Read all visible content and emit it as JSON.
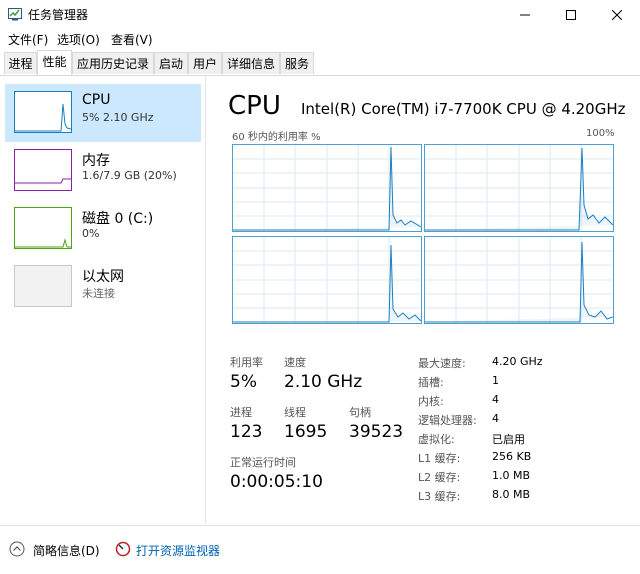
{
  "window": {
    "title": "任务管理器"
  },
  "menu": [
    "文件(F)",
    "选项(O)",
    "查看(V)"
  ],
  "tabs": [
    "进程",
    "性能",
    "应用历史记录",
    "启动",
    "用户",
    "详细信息",
    "服务"
  ],
  "sidebar": {
    "items": [
      {
        "name": "CPU",
        "value": "5%  2.10 GHz",
        "color": "#1b7fbf"
      },
      {
        "name": "内存",
        "value": "1.6/7.9 GB (20%)",
        "color": "#8b1fa8"
      },
      {
        "name": "磁盘 0 (C:)",
        "value": "0%",
        "color": "#4da60c"
      },
      {
        "name": "以太网",
        "value": "未连接",
        "color": "#b0b0b0"
      }
    ]
  },
  "main": {
    "title": "CPU",
    "model": "Intel(R) Core(TM) i7-7700K CPU @ 4.20GHz",
    "graph_label": "60 秒内的利用率 %",
    "graph_max": "100%",
    "stats": {
      "util_label": "利用率",
      "util_value": "5%",
      "speed_label": "速度",
      "speed_value": "2.10 GHz",
      "proc_label": "进程",
      "proc_value": "123",
      "thread_label": "线程",
      "thread_value": "1695",
      "handle_label": "句柄",
      "handle_value": "39523",
      "uptime_label": "正常运行时间",
      "uptime_value": "0:00:05:10"
    },
    "details": [
      {
        "key": "最大速度:",
        "value": "4.20 GHz"
      },
      {
        "key": "插槽:",
        "value": "1"
      },
      {
        "key": "内核:",
        "value": "4"
      },
      {
        "key": "逻辑处理器:",
        "value": "4"
      },
      {
        "key": "虚拟化:",
        "value": "已启用"
      },
      {
        "key": "L1 缓存:",
        "value": "256 KB"
      },
      {
        "key": "L2 缓存:",
        "value": "1.0 MB"
      },
      {
        "key": "L3 缓存:",
        "value": "8.0 MB"
      }
    ]
  },
  "footer": {
    "summary": "简略信息(D)",
    "monitor": "打开资源监视器"
  },
  "colors": {
    "accent": "#1b7fbf",
    "selected": "#cce8ff",
    "link": "#0063b1"
  }
}
